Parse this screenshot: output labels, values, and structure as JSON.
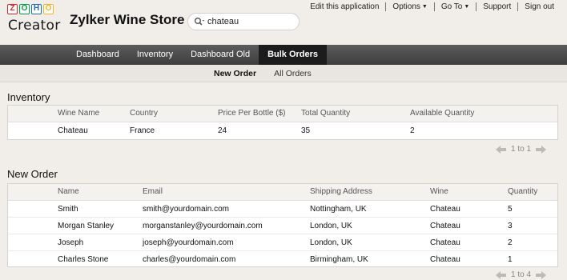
{
  "header": {
    "logo_letters": [
      "Z",
      "O",
      "H",
      "O"
    ],
    "logo_letter_colors": [
      "#e42527",
      "#089949",
      "#226db4",
      "#f9b21d"
    ],
    "logo_word": "Creator",
    "app_title": "Zylker Wine Store",
    "search_value": "chateau",
    "links": {
      "edit": "Edit this application",
      "options": "Options",
      "goto": "Go To",
      "support": "Support",
      "signout": "Sign out"
    }
  },
  "nav": {
    "tabs": [
      "Dashboard",
      "Inventory",
      "Dashboard Old",
      "Bulk Orders"
    ],
    "active": "Bulk Orders"
  },
  "subtabs": {
    "items": [
      "New Order",
      "All Orders"
    ],
    "active": "New Order"
  },
  "inventory": {
    "title": "Inventory",
    "columns": [
      "Wine Name",
      "Country",
      "Price Per Bottle ($)",
      "Total Quantity",
      "Available Quantity"
    ],
    "rows": [
      [
        "Chateau",
        "France",
        "24",
        "35",
        "2"
      ]
    ],
    "pager": "1 to 1"
  },
  "new_order": {
    "title": "New Order",
    "columns": [
      "Name",
      "Email",
      "Shipping Address",
      "Wine",
      "Quantity"
    ],
    "rows": [
      [
        "Smith",
        "smith@yourdomain.com",
        "Nottingham, UK",
        "Chateau",
        "5"
      ],
      [
        "Morgan Stanley",
        "morganstanley@yourdomain.com",
        "London, UK",
        "Chateau",
        "3"
      ],
      [
        "Joseph",
        "joseph@yourdomain.com",
        "London, UK",
        "Chateau",
        "2"
      ],
      [
        "Charles Stone",
        "charles@yourdomain.com",
        "Birmingham, UK",
        "Chateau",
        "1"
      ]
    ],
    "pager": "1 to 4"
  },
  "icons": {
    "search": "magnifier-icon",
    "prev": "arrow-left-icon",
    "next": "arrow-right-icon"
  }
}
